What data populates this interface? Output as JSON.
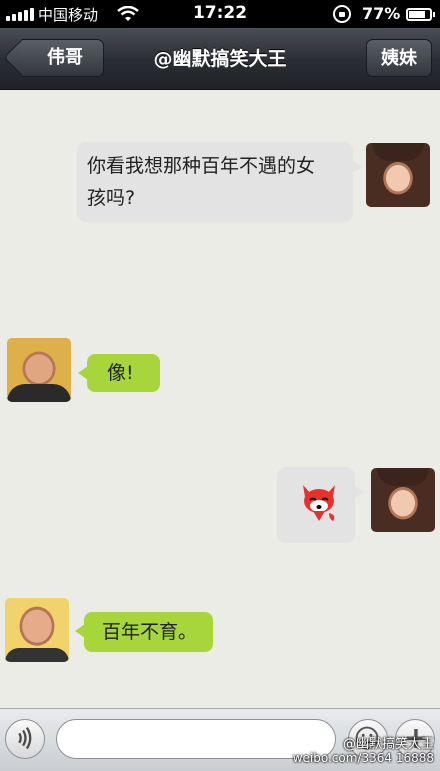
{
  "status_bar": {
    "carrier": "中国移动",
    "time": "17:22",
    "battery": "77%"
  },
  "nav": {
    "back_label": "伟哥",
    "title": "@幽默搞笑大王",
    "right_label": "姨妹"
  },
  "messages": [
    {
      "sender": "right",
      "avatar": "woman-avatar",
      "text_lines": [
        "你看我想那种百年不遇的女",
        "孩吗?"
      ]
    },
    {
      "sender": "left",
      "avatar": "man-avatar",
      "text": "像!"
    },
    {
      "sender": "right",
      "avatar": "woman-avatar",
      "sticker": "fox-emoji-icon"
    },
    {
      "sender": "left",
      "avatar": "man-avatar",
      "text": "百年不育。"
    }
  ],
  "input": {
    "value": "",
    "placeholder": ""
  },
  "watermark": {
    "name": "@幽默搞笑大王",
    "url": "weibo.com/3364 16888"
  }
}
